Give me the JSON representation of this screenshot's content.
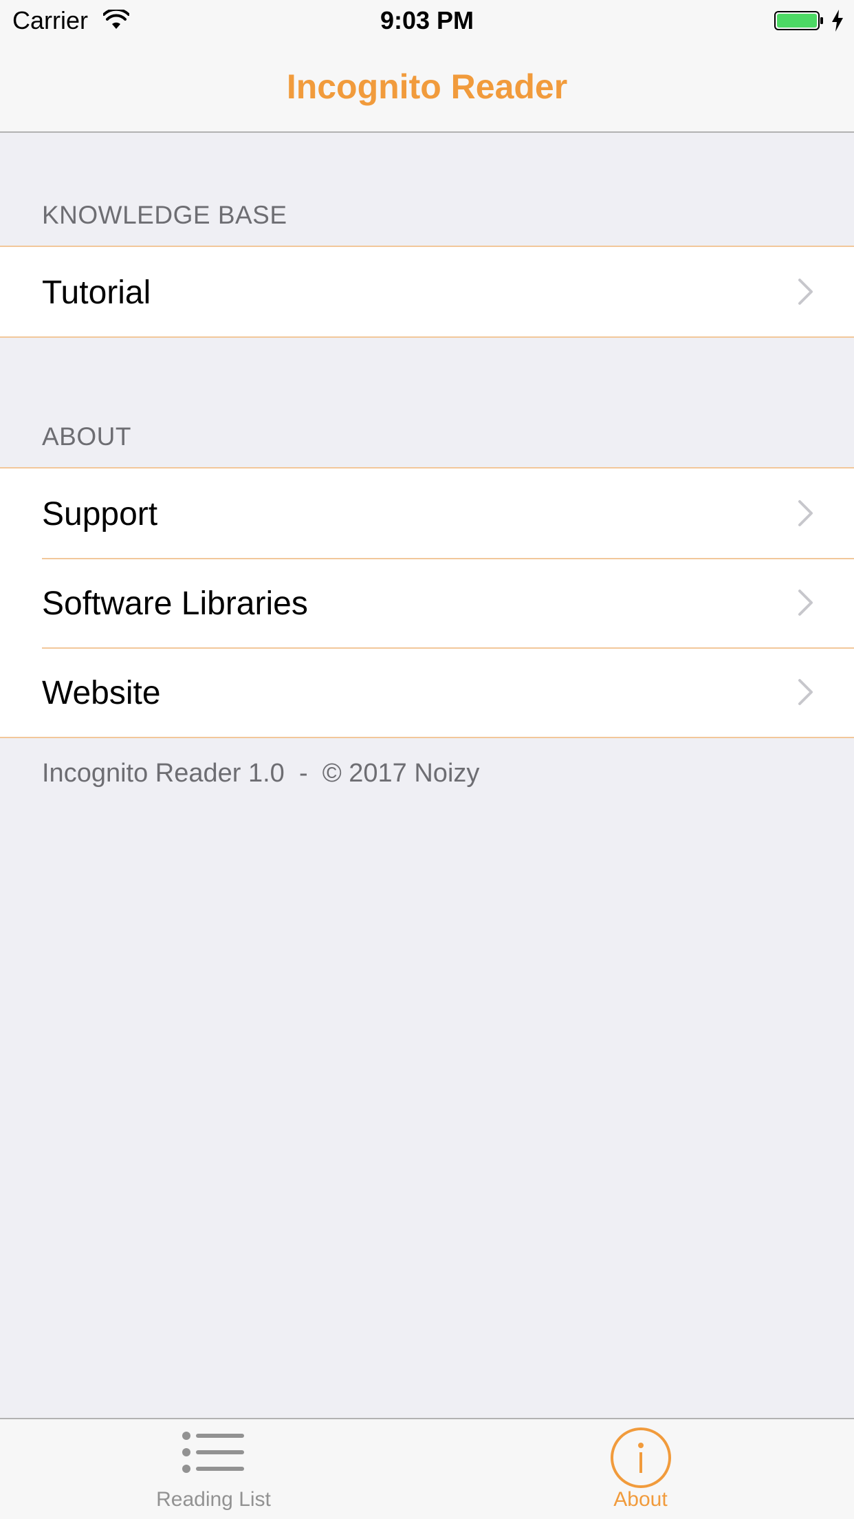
{
  "status_bar": {
    "carrier": "Carrier",
    "time": "9:03 PM",
    "battery_color": "#4cd964"
  },
  "nav": {
    "title": "Incognito Reader",
    "accent_color": "#f19b3c"
  },
  "sections": [
    {
      "header": "KNOWLEDGE BASE",
      "rows": [
        {
          "label": "Tutorial"
        }
      ]
    },
    {
      "header": "ABOUT",
      "rows": [
        {
          "label": "Support"
        },
        {
          "label": "Software Libraries"
        },
        {
          "label": "Website"
        }
      ]
    }
  ],
  "footer": {
    "app_name_version": "Incognito Reader 1.0",
    "separator": "-",
    "copyright": "© 2017 Noizy"
  },
  "tab_bar": {
    "tabs": [
      {
        "label": "Reading List",
        "icon": "list-icon",
        "selected": false
      },
      {
        "label": "About",
        "icon": "info-circle-icon",
        "selected": true
      }
    ]
  }
}
